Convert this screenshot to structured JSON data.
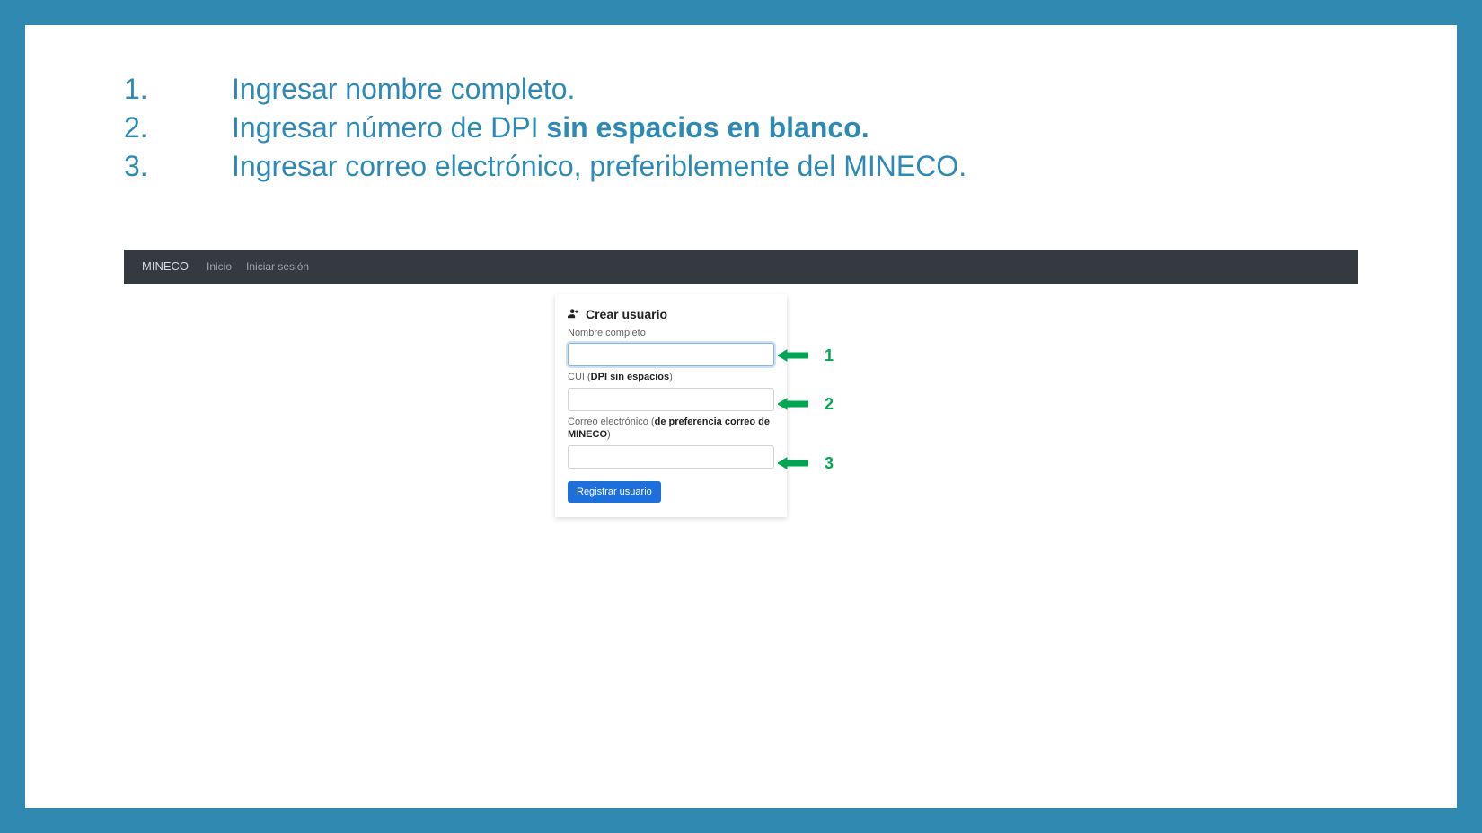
{
  "instructions": [
    {
      "num": "1.",
      "text": "Ingresar nombre completo."
    },
    {
      "num": "2.",
      "prefix": "Ingresar número de DPI ",
      "bold": "sin espacios en blanco."
    },
    {
      "num": "3.",
      "text": "Ingresar correo electrónico, preferiblemente del MINECO."
    }
  ],
  "navbar": {
    "brand": "MINECO",
    "links": [
      "Inicio",
      "Iniciar sesión"
    ]
  },
  "form": {
    "title": "Crear usuario",
    "label_name": "Nombre completo",
    "label_cui_prefix": "CUI (",
    "label_cui_bold": "DPI sin espacios",
    "label_cui_suffix": ")",
    "label_email_prefix": "Correo electrónico (",
    "label_email_bold": "de preferencia correo de MINECO",
    "label_email_suffix": ")",
    "submit": "Registrar usuario"
  },
  "arrows": [
    "1",
    "2",
    "3"
  ]
}
